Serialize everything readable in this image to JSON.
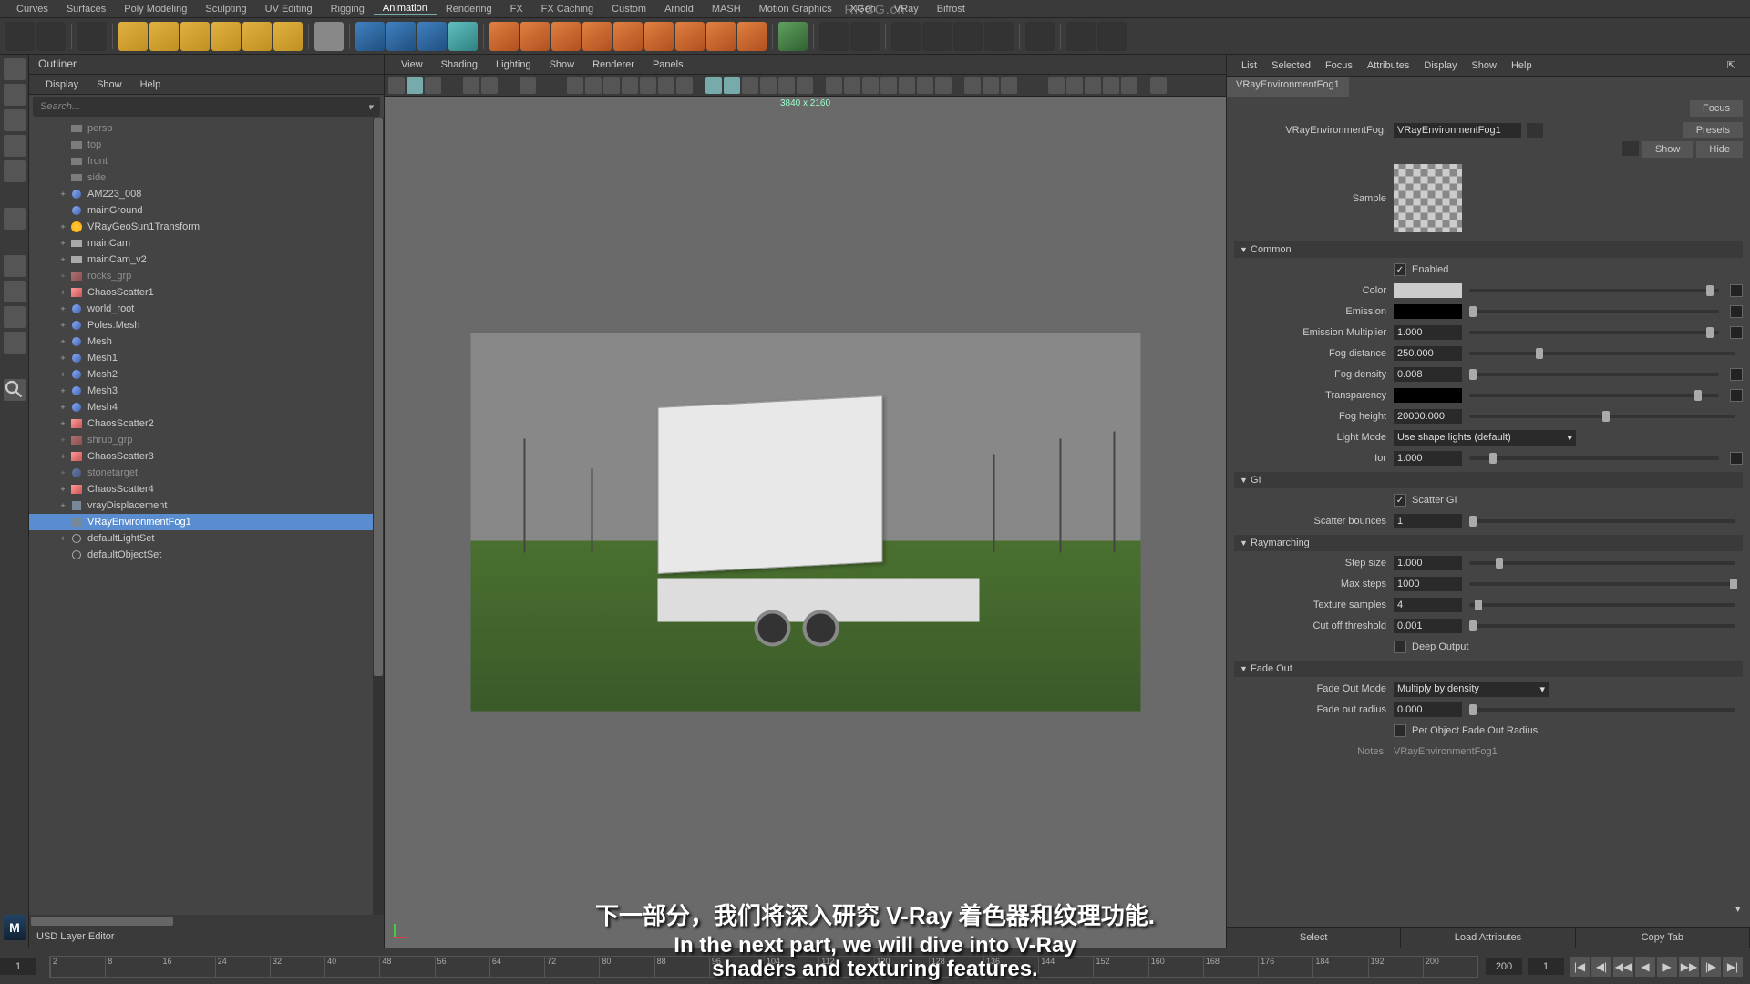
{
  "watermark": "RRCG.cn",
  "menubar": [
    "Curves",
    "Surfaces",
    "Poly Modeling",
    "Sculpting",
    "UV Editing",
    "Rigging",
    "Animation",
    "Rendering",
    "FX",
    "FX Caching",
    "Custom",
    "Arnold",
    "MASH",
    "Motion Graphics",
    "XGen",
    "VRay",
    "Bifrost"
  ],
  "menubar_active": "Animation",
  "outliner": {
    "title": "Outliner",
    "menu": [
      "Display",
      "Show",
      "Help"
    ],
    "search_placeholder": "Search...",
    "footer": "USD Layer Editor",
    "items": [
      {
        "label": "persp",
        "indent": 1,
        "icon": "cam",
        "dim": true
      },
      {
        "label": "top",
        "indent": 1,
        "icon": "cam",
        "dim": true
      },
      {
        "label": "front",
        "indent": 1,
        "icon": "cam",
        "dim": true
      },
      {
        "label": "side",
        "indent": 1,
        "icon": "cam",
        "dim": true
      },
      {
        "label": "AM223_008",
        "indent": 1,
        "icon": "sphere",
        "exp": "+"
      },
      {
        "label": "mainGround",
        "indent": 1,
        "icon": "sphere"
      },
      {
        "label": "VRayGeoSun1Transform",
        "indent": 1,
        "icon": "sun",
        "exp": "+"
      },
      {
        "label": "mainCam",
        "indent": 1,
        "icon": "cam",
        "exp": "+"
      },
      {
        "label": "mainCam_v2",
        "indent": 1,
        "icon": "cam",
        "exp": "+"
      },
      {
        "label": "rocks_grp",
        "indent": 1,
        "icon": "grp",
        "exp": "+",
        "dim": true
      },
      {
        "label": "ChaosScatter1",
        "indent": 1,
        "icon": "grp",
        "exp": "+"
      },
      {
        "label": "world_root",
        "indent": 1,
        "icon": "sphere",
        "exp": "+"
      },
      {
        "label": "Poles:Mesh",
        "indent": 1,
        "icon": "sphere",
        "exp": "+"
      },
      {
        "label": "Mesh",
        "indent": 1,
        "icon": "sphere",
        "exp": "+"
      },
      {
        "label": "Mesh1",
        "indent": 1,
        "icon": "sphere",
        "exp": "+"
      },
      {
        "label": "Mesh2",
        "indent": 1,
        "icon": "sphere",
        "exp": "+"
      },
      {
        "label": "Mesh3",
        "indent": 1,
        "icon": "sphere",
        "exp": "+"
      },
      {
        "label": "Mesh4",
        "indent": 1,
        "icon": "sphere",
        "exp": "+"
      },
      {
        "label": "ChaosScatter2",
        "indent": 1,
        "icon": "grp",
        "exp": "+"
      },
      {
        "label": "shrub_grp",
        "indent": 1,
        "icon": "grp",
        "exp": "+",
        "dim": true
      },
      {
        "label": "ChaosScatter3",
        "indent": 1,
        "icon": "grp",
        "exp": "+"
      },
      {
        "label": "stonetarget",
        "indent": 1,
        "icon": "sphere",
        "exp": "+",
        "dim": true
      },
      {
        "label": "ChaosScatter4",
        "indent": 1,
        "icon": "grp",
        "exp": "+"
      },
      {
        "label": "vrayDisplacement",
        "indent": 1,
        "icon": "mesh",
        "exp": "+"
      },
      {
        "label": "VRayEnvironmentFog1",
        "indent": 1,
        "icon": "mesh",
        "selected": true
      },
      {
        "label": "defaultLightSet",
        "indent": 1,
        "icon": "ring",
        "exp": "+"
      },
      {
        "label": "defaultObjectSet",
        "indent": 1,
        "icon": "ring"
      }
    ]
  },
  "viewport": {
    "menu": [
      "View",
      "Shading",
      "Lighting",
      "Show",
      "Renderer",
      "Panels"
    ],
    "resolution": "3840 x 2160"
  },
  "attr": {
    "menu": [
      "List",
      "Selected",
      "Focus",
      "Attributes",
      "Display",
      "Show",
      "Help"
    ],
    "tab": "VRayEnvironmentFog1",
    "node_type_label": "VRayEnvironmentFog:",
    "node_name": "VRayEnvironmentFog1",
    "buttons": {
      "focus": "Focus",
      "presets": "Presets",
      "show": "Show",
      "hide": "Hide"
    },
    "sample_label": "Sample",
    "sections": {
      "common": "Common",
      "gi": "GI",
      "raymarching": "Raymarching",
      "fadeout": "Fade Out"
    },
    "fields": {
      "enabled": {
        "label": "Enabled",
        "checked": true
      },
      "color": {
        "label": "Color"
      },
      "emission": {
        "label": "Emission"
      },
      "emission_mult": {
        "label": "Emission Multiplier",
        "value": "1.000"
      },
      "fog_distance": {
        "label": "Fog distance",
        "value": "250.000"
      },
      "fog_density": {
        "label": "Fog density",
        "value": "0.008"
      },
      "transparency": {
        "label": "Transparency"
      },
      "fog_height": {
        "label": "Fog height",
        "value": "20000.000"
      },
      "light_mode": {
        "label": "Light Mode",
        "value": "Use shape lights (default)"
      },
      "ior": {
        "label": "Ior",
        "value": "1.000"
      },
      "scatter_gi": {
        "label": "Scatter GI",
        "checked": true
      },
      "scatter_bounces": {
        "label": "Scatter bounces",
        "value": "1"
      },
      "step_size": {
        "label": "Step size",
        "value": "1.000"
      },
      "max_steps": {
        "label": "Max steps",
        "value": "1000"
      },
      "texture_samples": {
        "label": "Texture samples",
        "value": "4"
      },
      "cutoff": {
        "label": "Cut off threshold",
        "value": "0.001"
      },
      "deep_output": {
        "label": "Deep Output",
        "checked": false
      },
      "fade_mode": {
        "label": "Fade Out Mode",
        "value": "Multiply by density"
      },
      "fade_radius": {
        "label": "Fade out radius",
        "value": "0.000"
      },
      "per_object": {
        "label": "Per Object Fade Out Radius",
        "checked": false
      }
    },
    "notes_label": "Notes:",
    "notes_value": "VRayEnvironmentFog1",
    "footer": {
      "select": "Select",
      "load": "Load Attributes",
      "copy": "Copy Tab"
    }
  },
  "timeline": {
    "start": "1",
    "end": "200",
    "current": "1",
    "ticks": [
      "2",
      "8",
      "16",
      "24",
      "32",
      "40",
      "48",
      "56",
      "64",
      "72",
      "80",
      "88",
      "96",
      "104",
      "112",
      "120",
      "128",
      "136",
      "144",
      "152",
      "160",
      "168",
      "176",
      "184",
      "192",
      "200"
    ]
  },
  "subtitles": {
    "line1": "下一部分，我们将深入研究 V-Ray 着色器和纹理功能.",
    "line2": "In the next part, we will dive into V-Ray",
    "line3": "shaders and texturing features."
  },
  "badge": "M"
}
